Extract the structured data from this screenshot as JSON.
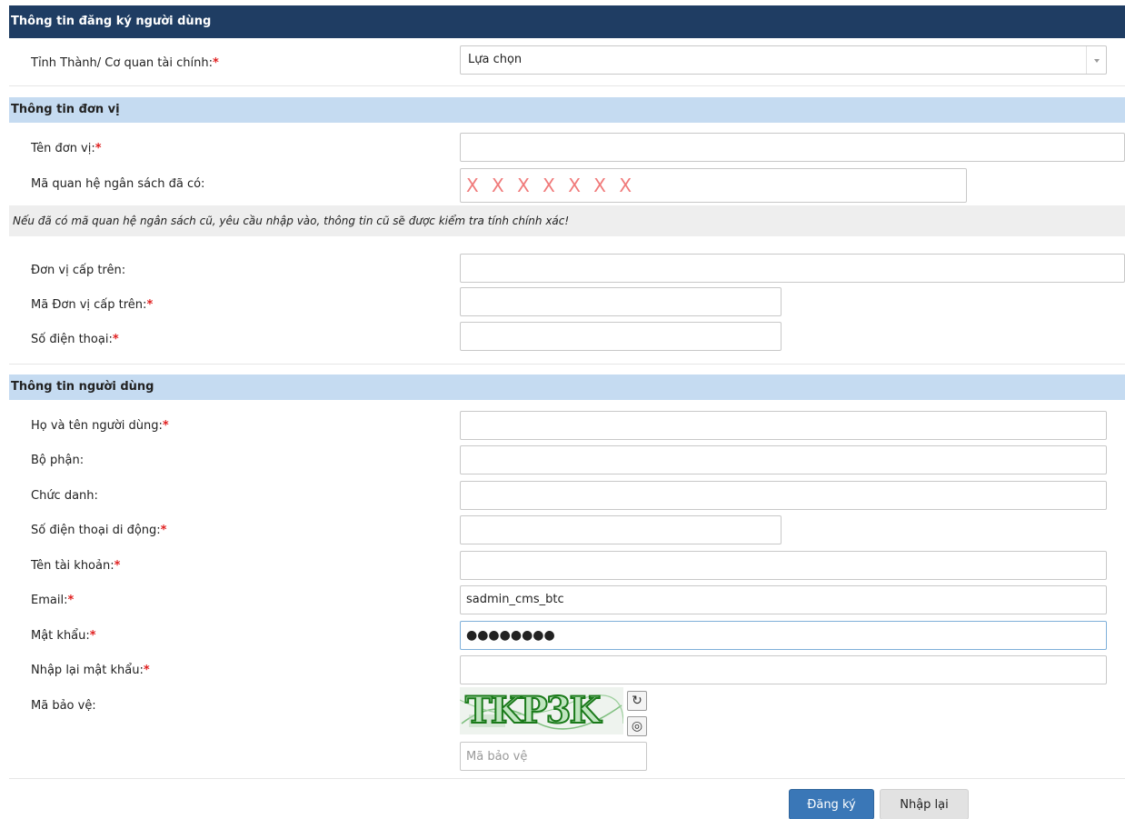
{
  "header": {
    "title": "Thông tin đăng ký người dùng"
  },
  "province": {
    "label": "Tỉnh Thành/ Cơ quan tài chính:",
    "required": "*",
    "selected": "Lựa chọn"
  },
  "unit_section": {
    "title": "Thông tin đơn vị",
    "unit_name": {
      "label": "Tên đơn vị:",
      "required": "*",
      "value": ""
    },
    "budget_code": {
      "label": "Mã quan hệ ngân sách đã có:",
      "value": "X X X X X X X"
    },
    "note": "Nếu đã có mã quan hệ ngân sách cũ, yêu cầu nhập vào, thông tin cũ sẽ được kiểm tra tính chính xác!",
    "parent_unit": {
      "label": "Đơn vị cấp trên:",
      "value": ""
    },
    "parent_code": {
      "label": "Mã Đơn vị cấp trên:",
      "required": "*",
      "value": ""
    },
    "phone": {
      "label": "Số điện thoại:",
      "required": "*",
      "value": ""
    }
  },
  "user_section": {
    "title": "Thông tin người dùng",
    "full_name": {
      "label": "Họ và tên người dùng:",
      "required": "*",
      "value": ""
    },
    "department": {
      "label": "Bộ phận:",
      "value": ""
    },
    "position": {
      "label": "Chức danh:",
      "value": ""
    },
    "mobile": {
      "label": "Số điện thoại di động:",
      "required": "*",
      "value": ""
    },
    "account": {
      "label": "Tên tài khoản:",
      "required": "*",
      "value": ""
    },
    "email": {
      "label": "Email:",
      "required": "*",
      "value": "sadmin_cms_btc"
    },
    "password": {
      "label": "Mật khẩu:",
      "required": "*",
      "value": "●●●●●●●●"
    },
    "password_confirm": {
      "label": "Nhập lại mật khẩu:",
      "required": "*",
      "value": ""
    },
    "captcha": {
      "label": "Mã bảo vệ:",
      "image_text": "TKP3K",
      "placeholder": "Mã bảo vệ",
      "refresh_icon": "refresh-icon",
      "audio_icon": "audio-icon"
    }
  },
  "actions": {
    "submit_label": "Đăng ký",
    "reset_label": "Nhập lại"
  },
  "colors": {
    "header_bg": "#1f3d63",
    "section_bg": "#c5dbf1",
    "primary_button": "#3a77b7",
    "required": "#e02020"
  }
}
